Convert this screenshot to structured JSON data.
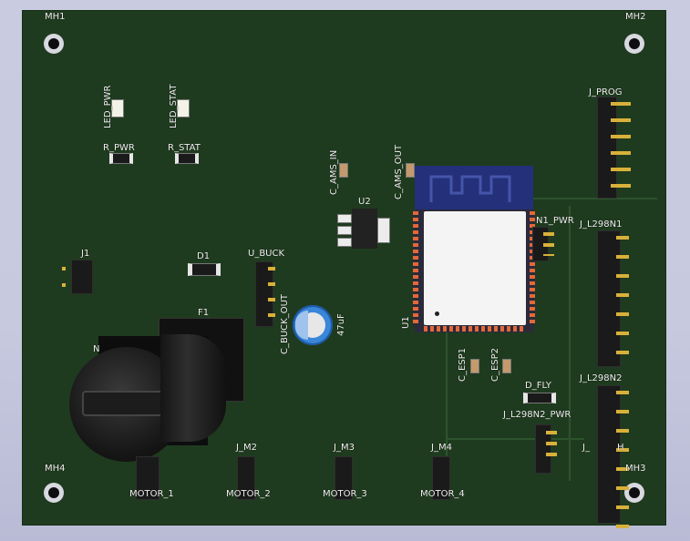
{
  "labels": {
    "mh1": "MH1",
    "mh2": "MH2",
    "mh3": "MH3",
    "mh4": "MH4",
    "led_pwr": "LED_PWR",
    "led_stat": "LED_STAT",
    "r_pwr": "R_PWR",
    "r_stat": "R_STAT",
    "c_ams_in": "C_AMS_IN",
    "c_ams_out": "C_AMS_OUT",
    "u2": "U2",
    "j_prog": "J_PROG",
    "n1_pwr": "N1_PWR",
    "j_l298n1": "J_L298N1",
    "j_l298n2": "J_L298N2",
    "j1": "J1",
    "d1": "D1",
    "u_buck": "U_BUCK",
    "c_buck_out": "C_BUCK_OUT",
    "cap_value": "47uF",
    "f1": "F1",
    "n_partial": "N",
    "u1": "U1",
    "c_esp1": "C_ESP1",
    "c_esp2": "C_ESP2",
    "d_fly": "D_FLY",
    "j_l298n2_pwr": "J_L298N2_PWR",
    "j_m2": "J_M2",
    "j_m3": "J_M3",
    "j_m4": "J_M4",
    "motor_1": "MOTOR_1",
    "motor_2": "MOTOR_2",
    "motor_3": "MOTOR_3",
    "motor_4": "MOTOR_4",
    "j_partial": "J_",
    "h_partial": "H"
  }
}
